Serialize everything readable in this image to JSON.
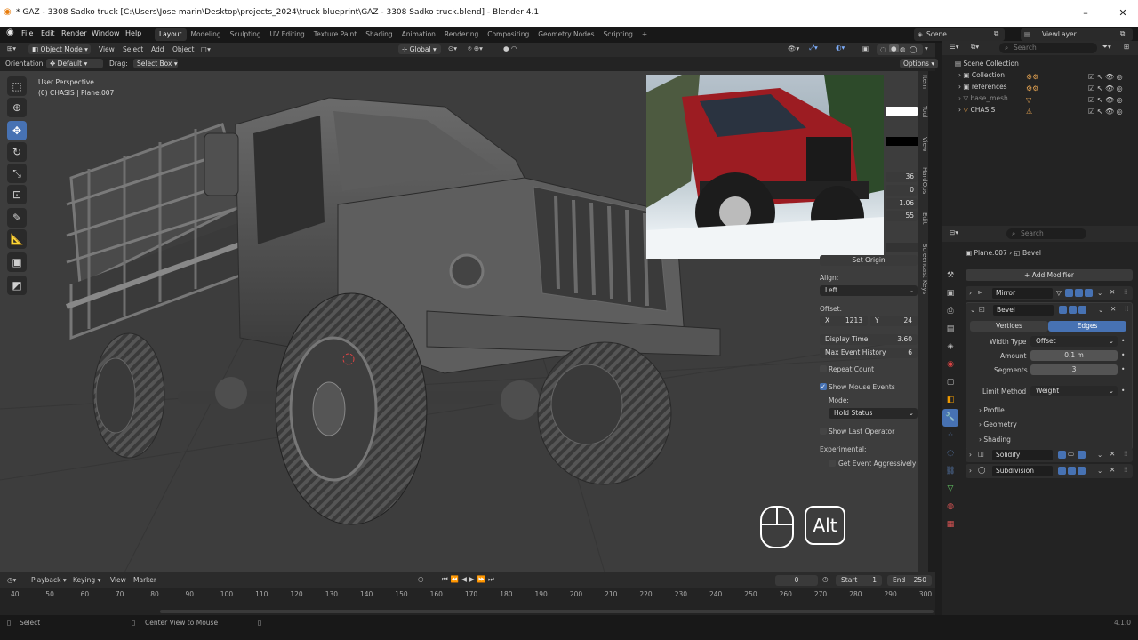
{
  "titlebar": {
    "text": "* GAZ - 3308 Sadko truck [C:\\Users\\Jose marin\\Desktop\\projects_2024\\truck blueprint\\GAZ - 3308 Sadko truck.blend] - Blender 4.1",
    "min": "–",
    "max": "▢",
    "close": "✕"
  },
  "menu": {
    "file": "File",
    "edit": "Edit",
    "render": "Render",
    "window": "Window",
    "help": "Help"
  },
  "workspaces": [
    "Layout",
    "Modeling",
    "Sculpting",
    "UV Editing",
    "Texture Paint",
    "Shading",
    "Animation",
    "Rendering",
    "Compositing",
    "Geometry Nodes",
    "Scripting",
    "+"
  ],
  "scene": "Scene",
  "viewlayer": "ViewLayer",
  "vp_header": {
    "mode": "Object Mode",
    "view": "View",
    "select": "Select",
    "add": "Add",
    "object": "Object",
    "transform": "Global",
    "options": "Options",
    "orientation_label": "Orientation:",
    "orientation": "Default",
    "drag_label": "Drag:",
    "drag": "Select Box"
  },
  "viewport": {
    "perspective": "User Perspective",
    "object_info": "(0) CHASIS | Plane.007"
  },
  "sidetabs": [
    "Item",
    "Tool",
    "View",
    "HardOps",
    "Edit",
    "Screencast Keys"
  ],
  "screencast": {
    "values": [
      "36",
      "0",
      "1.06",
      "55"
    ],
    "set_origin": "Set Origin",
    "align_label": "Align:",
    "align": "Left",
    "offset_label": "Offset:",
    "x_label": "X",
    "x": "1213",
    "y_label": "Y",
    "y": "24",
    "display_time_label": "Display Time",
    "display_time": "3.60",
    "max_history_label": "Max Event History",
    "max_history": "6",
    "repeat_count": "Repeat Count",
    "show_mouse": "Show Mouse Events",
    "mode_label": "Mode:",
    "mode": "Hold Status",
    "show_last": "Show Last Operator",
    "experimental_label": "Experimental:",
    "get_event": "Get Event Aggressively"
  },
  "keys": {
    "alt": "Alt"
  },
  "outliner": {
    "search": "Search",
    "items": [
      {
        "name": "Scene Collection"
      },
      {
        "name": "Collection"
      },
      {
        "name": "references"
      },
      {
        "name": "base_mesh"
      },
      {
        "name": "CHASIS"
      }
    ]
  },
  "props": {
    "search": "Search",
    "object": "Plane.007",
    "modifier": "Bevel",
    "add_modifier": "Add Modifier",
    "modifiers": [
      "Mirror",
      "Bevel",
      "Solidify",
      "Subdivision"
    ],
    "vertices": "Vertices",
    "edges": "Edges",
    "width_type_label": "Width Type",
    "width_type": "Offset",
    "amount_label": "Amount",
    "amount": "0.1 m",
    "segments_label": "Segments",
    "segments": "3",
    "limit_method_label": "Limit Method",
    "limit_method": "Weight",
    "profile": "Profile",
    "geometry": "Geometry",
    "shading": "Shading"
  },
  "timeline": {
    "playback": "Playback",
    "keying": "Keying",
    "view": "View",
    "marker": "Marker",
    "current_frame": "0",
    "start_label": "Start",
    "start": "1",
    "end_label": "End",
    "end": "250",
    "ticks": [
      "40",
      "50",
      "60",
      "70",
      "80",
      "90",
      "100",
      "110",
      "120",
      "130",
      "140",
      "150",
      "160",
      "170",
      "180",
      "190",
      "200",
      "210",
      "220",
      "230",
      "240",
      "250",
      "260",
      "270",
      "280",
      "290",
      "300"
    ]
  },
  "status": {
    "select": "Select",
    "center_view": "Center View to Mouse",
    "version": "4.1.0"
  },
  "colors": {
    "accent": "#4772b3",
    "viewport_bg": "#3d3d3d",
    "panel_bg": "#232323"
  }
}
